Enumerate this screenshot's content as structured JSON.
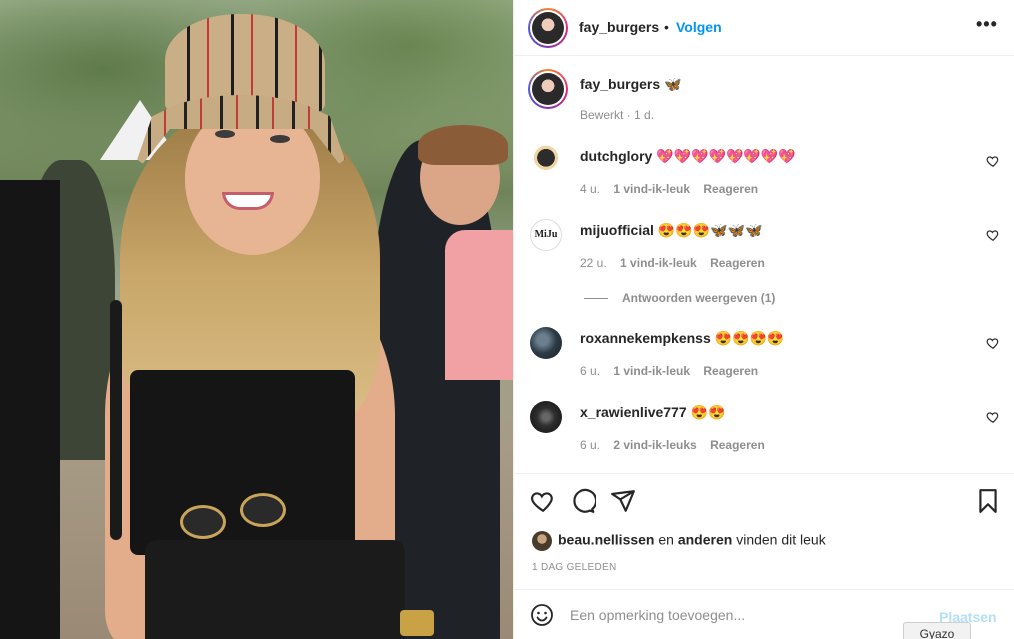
{
  "post": {
    "username": "fay_burgers",
    "dot": "•",
    "follow_label": "Volgen",
    "more_label": "•••"
  },
  "caption": {
    "username": "fay_burgers",
    "text": "🦋",
    "meta": "Bewerkt · 1 d."
  },
  "comments": [
    {
      "username": "dutchglory",
      "text": "💖💖💖💖💖💖💖💖",
      "time": "4 u.",
      "likes": "1 vind-ik-leuk",
      "reply": "Reageren"
    },
    {
      "username": "mijuofficial",
      "text": "😍😍😍🦋🦋🦋",
      "time": "22 u.",
      "likes": "1 vind-ik-leuk",
      "reply": "Reageren",
      "avatar_text": "MiJu"
    },
    {
      "username": "roxannekempkenss",
      "text": "😍😍😍😍",
      "time": "6 u.",
      "likes": "1 vind-ik-leuk",
      "reply": "Reageren"
    },
    {
      "username": "x_rawienlive777",
      "text": "😍😍",
      "time": "6 u.",
      "likes": "2 vind-ik-leuks",
      "reply": "Reageren"
    }
  ],
  "replies_label": "Antwoorden weergeven (1)",
  "likes": {
    "user": "beau.nellissen",
    "connector": "en",
    "others": "anderen",
    "suffix": "vinden dit leuk"
  },
  "date": "1 DAG GELEDEN",
  "comment_input": {
    "placeholder": "Een opmerking toevoegen...",
    "post_label": "Plaatsen"
  },
  "overlay": {
    "gyazo_label": "Gyazo"
  },
  "colors": {
    "accent": "#0095f6",
    "muted": "#8e8e8e",
    "text": "#262626",
    "disabled_accent": "#b2dffc"
  },
  "icons": [
    "heart-icon",
    "comment-icon",
    "share-icon",
    "bookmark-icon",
    "emoji-icon",
    "more-icon"
  ]
}
